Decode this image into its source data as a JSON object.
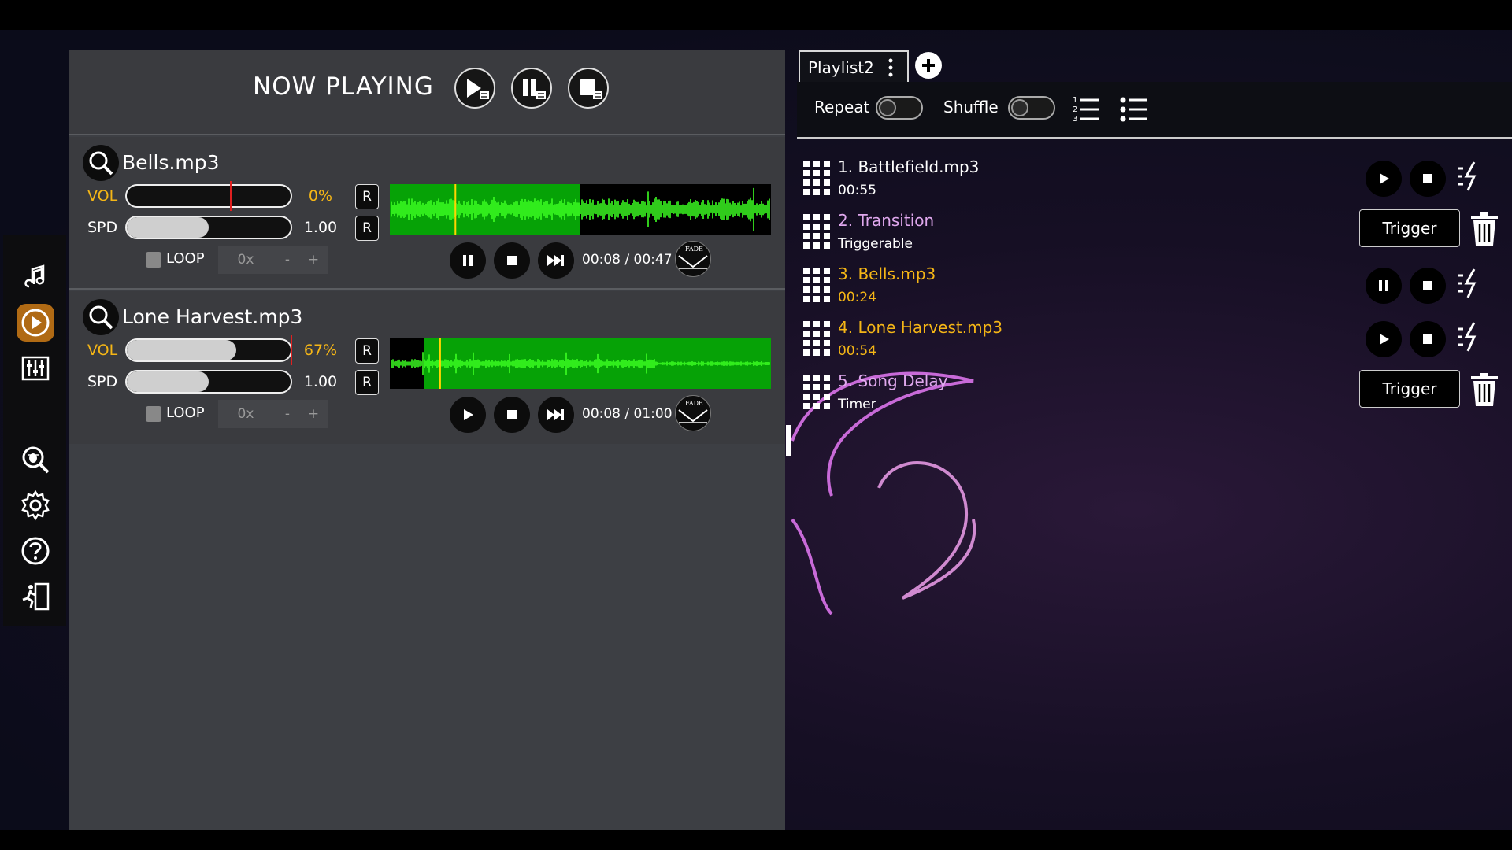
{
  "now_playing": {
    "title": "NOW PLAYING"
  },
  "tracks": [
    {
      "name": "Bells.mp3",
      "vol_label": "VOL",
      "vol_value": "0%",
      "vol_level": 0.0,
      "spd_label": "SPD",
      "spd_value": "1.00",
      "spd_level": 0.5,
      "reset_label": "R",
      "loop_label": "LOOP",
      "loop_count": "0x",
      "loop_minus": "-",
      "loop_plus": "+",
      "time": "00:08 / 00:47",
      "progress": 0.17,
      "played_fraction": 0.5,
      "state": "playing"
    },
    {
      "name": "Lone Harvest.mp3",
      "vol_label": "VOL",
      "vol_value": "67%",
      "vol_level": 0.67,
      "spd_label": "SPD",
      "spd_value": "1.00",
      "spd_level": 0.5,
      "reset_label": "R",
      "loop_label": "LOOP",
      "loop_count": "0x",
      "loop_minus": "-",
      "loop_plus": "+",
      "time": "00:08 / 01:00",
      "progress": 0.13,
      "state": "paused"
    }
  ],
  "playlist": {
    "tab_label": "Playlist2",
    "repeat_label": "Repeat",
    "shuffle_label": "Shuffle",
    "repeat_on": false,
    "shuffle_on": false,
    "trigger_label": "Trigger",
    "items": [
      {
        "name": "1.  Battlefield.mp3",
        "sub": "00:55",
        "name_color": "#ffffff",
        "sub_color": "#ffffff",
        "kind": "track",
        "state": "stopped"
      },
      {
        "name": "2.  Transition",
        "sub": "Triggerable",
        "name_color": "#e0a8ee",
        "sub_color": "#ffffff",
        "kind": "trigger"
      },
      {
        "name": "3.  Bells.mp3",
        "sub": "00:24",
        "name_color": "#f5b616",
        "sub_color": "#f5b616",
        "kind": "track",
        "state": "playing"
      },
      {
        "name": "4.  Lone Harvest.mp3",
        "sub": "00:54",
        "name_color": "#f5b616",
        "sub_color": "#f5b616",
        "kind": "track",
        "state": "paused"
      },
      {
        "name": "5.  Song Delay",
        "sub": "Timer",
        "name_color": "#e0a8ee",
        "sub_color": "#ffffff",
        "kind": "trigger"
      }
    ]
  },
  "nav": [
    "music-note-icon",
    "play-circle-icon",
    "soundboard-icon",
    "bug-search-icon",
    "gear-icon",
    "help-icon",
    "exit-icon"
  ],
  "colors": {
    "accent_gold": "#f5b616",
    "nav_active": "#b06a14",
    "waveform": "#3cff22",
    "waveform_bg": "#06a206",
    "playhead": "#ffd400",
    "vol_marker": "#e02020"
  }
}
